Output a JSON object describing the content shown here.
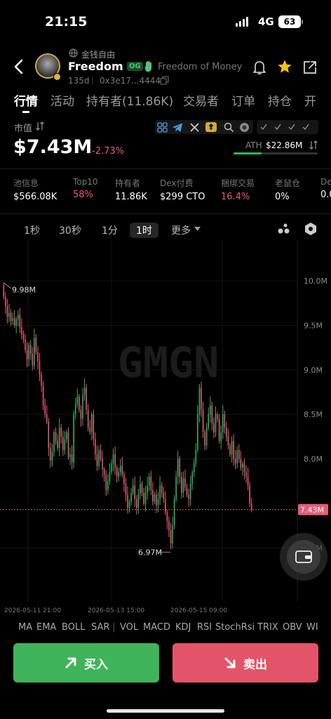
{
  "status": {
    "time": "21:15",
    "network": "4G",
    "battery": "63"
  },
  "token": {
    "tag": "金钱自由",
    "name": "Freedom ...",
    "badge": "OG",
    "full_name": "Freedom of Money",
    "age": "135d",
    "address": "0x3e17...4444"
  },
  "tabs": [
    "行情",
    "活动",
    "持有者(11.86K)",
    "交易者",
    "订单",
    "持仓",
    "开"
  ],
  "market": {
    "label": "市值",
    "value": "$7.43M",
    "change": "-2.73%",
    "ath_label": "ATH",
    "ath_value": "$22.86M",
    "ath_progress": 0.33
  },
  "stats": [
    {
      "label": "池信息",
      "value": "$566.08K"
    },
    {
      "label": "Top10",
      "value": "58%"
    },
    {
      "label": "持有者",
      "value": "11.86K"
    },
    {
      "label": "Dex付费",
      "value": "$299 CTO"
    },
    {
      "label": "捆绑交易",
      "value": "16.4%"
    },
    {
      "label": "老鼠仓",
      "value": "0%"
    },
    {
      "label": "De",
      "value": "0.0"
    }
  ],
  "timeframes": {
    "t1": "1秒",
    "t2": "30秒",
    "t3": "1分",
    "t4": "1时",
    "more": "更多"
  },
  "chart_data": {
    "type": "candlestick",
    "watermark": "GMGN",
    "y_ticks": [
      "10.0M",
      "9.5M",
      "9.0M",
      "8.5M",
      "8.0M",
      "7.0M"
    ],
    "ylim": [
      6.75,
      10.3
    ],
    "x_ticks": [
      "2026-05-11 21:00",
      "2026-05-13 15:00",
      "2026-05-15 09:00"
    ],
    "high_label": "9.98M",
    "low_label": "6.97M",
    "current_label": "7.43M",
    "current_value": 7.43,
    "close": [
      9.82,
      9.72,
      9.6,
      9.64,
      9.55,
      9.58,
      9.5,
      9.57,
      9.62,
      9.48,
      9.4,
      9.34,
      9.22,
      9.12,
      9.28,
      9.18,
      9.05,
      9.36,
      9.2,
      9.1,
      8.95,
      8.82,
      8.6,
      8.5,
      8.42,
      8.12,
      7.98,
      8.08,
      8.3,
      8.2,
      8.12,
      8.35,
      8.25,
      8.1,
      8.22,
      8.3,
      8.02,
      8.05,
      7.96,
      8.5,
      8.62,
      8.7,
      8.55,
      8.45,
      8.72,
      8.8,
      8.55,
      8.35,
      8.3,
      8.5,
      8.22,
      8.05,
      7.92,
      8.1,
      8.0,
      7.88,
      7.82,
      7.65,
      7.75,
      7.85,
      7.95,
      8.05,
      7.9,
      7.8,
      7.85,
      7.92,
      7.82,
      7.72,
      7.6,
      7.45,
      7.52,
      7.62,
      7.7,
      7.55,
      7.45,
      7.6,
      7.72,
      7.62,
      7.5,
      7.62,
      7.7,
      7.8,
      7.65,
      7.52,
      7.6,
      7.48,
      7.55,
      7.7,
      7.62,
      7.55,
      7.4,
      7.3,
      7.2,
      7.05,
      7.25,
      7.55,
      7.8,
      8.0,
      7.8,
      7.62,
      7.78,
      7.68,
      7.6,
      7.55,
      7.72,
      7.85,
      7.95,
      8.1,
      8.5,
      8.8,
      8.55,
      8.3,
      8.15,
      8.35,
      8.5,
      8.6,
      8.4,
      8.3,
      8.5,
      8.45,
      8.2,
      8.3,
      8.5,
      8.35,
      8.25,
      8.15,
      8.05,
      8.2,
      8.0,
      7.95,
      8.1,
      8.0,
      7.9,
      7.95,
      7.85,
      7.8,
      7.7,
      7.5,
      7.43
    ]
  },
  "indicators": [
    "MA",
    "EMA",
    "BOLL",
    "SAR",
    "|",
    "VOL",
    "MACD",
    "KDJ",
    "RSI",
    "StochRsi",
    "TRIX",
    "OBV",
    "WI"
  ],
  "actions": {
    "buy": "买入",
    "sell": "卖出"
  },
  "colors": {
    "up": "#2fb55e",
    "down": "#e35d75",
    "buy_bg": "#3fb35a",
    "sell_bg": "#e45469",
    "accent": "#4a9ae8",
    "star": "#f3c419"
  }
}
